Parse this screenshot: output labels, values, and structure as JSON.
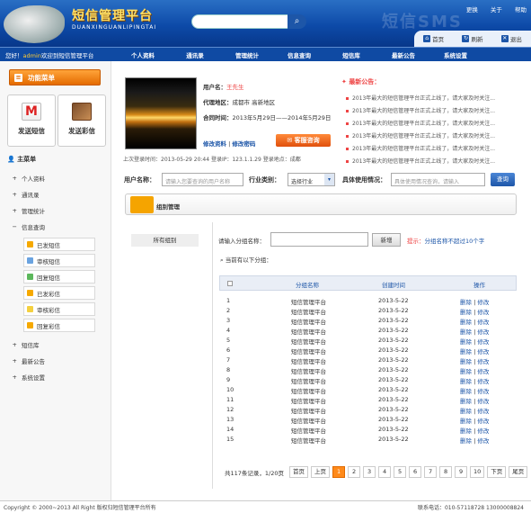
{
  "header": {
    "title": "短信管理平台",
    "subtitle": "DUANXINGUANLIPINGTAI",
    "watermark": "短信SMS",
    "top_links": [
      "更换",
      "关于",
      "帮助"
    ],
    "toolbar": [
      {
        "icon": "home-icon",
        "label": "首页"
      },
      {
        "icon": "refresh-icon",
        "label": "刷新"
      },
      {
        "icon": "logout-icon",
        "label": "退出"
      }
    ]
  },
  "nav": {
    "greeting_prefix": "您好！",
    "username": "admin",
    "greeting_suffix": "欢迎到短信管理平台",
    "items": [
      "个人资料",
      "通讯录",
      "管理统计",
      "信息查询",
      "短信库",
      "最新公告",
      "系统设置"
    ]
  },
  "sidebar": {
    "function_menu": "功能菜单",
    "send_sms": "发送短信",
    "send_mms": "发送彩信",
    "main_menu": "主菜单",
    "items": [
      "个人资料",
      "通讯录",
      "管理统计",
      "信息查询"
    ],
    "subitems": [
      "已发短信",
      "审核短信",
      "回复短信",
      "已发彩信",
      "审核彩信",
      "回复彩信"
    ],
    "items2": [
      "短信库",
      "最新公告",
      "系统设置"
    ]
  },
  "user": {
    "name_label": "用户名：",
    "name_value": "王先生",
    "region_label": "代理地区：",
    "region_value": "成都市 高新地区",
    "contract_label": "合同时间：",
    "contract_value": "2013年5月29日——2014年5月29日",
    "edit_profile": "修改资料",
    "sep": "|",
    "edit_password": "修改密码",
    "consult": "客服咨询",
    "last_login": "上次登录时间：2013-05-29  20:44  登录IP：123.1.1.29  登录地点：成都"
  },
  "notices": {
    "title": "最新公告：",
    "items": [
      "2013年最大的短信管理平台正式上线了，请大家及时关注...",
      "2013年最大的短信管理平台正式上线了，请大家及时关注...",
      "2013年最大的短信管理平台正式上线了，请大家及时关注...",
      "2013年最大的短信管理平台正式上线了，请大家及时关注...",
      "2013年最大的短信管理平台正式上线了，请大家及时关注...",
      "2013年最大的短信管理平台正式上线了，请大家及时关注..."
    ]
  },
  "query": {
    "user_label": "用户名称：",
    "user_placeholder": "请输入您要查询的用户名称",
    "industry_label": "行业类别：",
    "industry_value": "选择行业",
    "usage_label": "具体使用情况：",
    "usage_placeholder": "具体使用情况查询，请输入",
    "search": "查询"
  },
  "group": {
    "title": "组别管理",
    "all": "所有组别",
    "name_label": "请输入分组名称：",
    "new_btn": "新增",
    "tip_prefix": "提示：",
    "tip_text": "分组名称不超过10个字",
    "existing": "当前有以下分组：",
    "col_name": "分组名称",
    "col_time": "创建时间",
    "col_op": "操作",
    "rows": [
      {
        "no": "1",
        "name": "短信管理平台",
        "time": "2013-5-22",
        "del": "删除",
        "edit": "修改"
      },
      {
        "no": "2",
        "name": "短信管理平台",
        "time": "2013-5-22",
        "del": "删除",
        "edit": "修改"
      },
      {
        "no": "3",
        "name": "短信管理平台",
        "time": "2013-5-22",
        "del": "删除",
        "edit": "修改"
      },
      {
        "no": "4",
        "name": "短信管理平台",
        "time": "2013-5-22",
        "del": "删除",
        "edit": "修改"
      },
      {
        "no": "5",
        "name": "短信管理平台",
        "time": "2013-5-22",
        "del": "删除",
        "edit": "修改"
      },
      {
        "no": "6",
        "name": "短信管理平台",
        "time": "2013-5-22",
        "del": "删除",
        "edit": "修改"
      },
      {
        "no": "7",
        "name": "短信管理平台",
        "time": "2013-5-22",
        "del": "删除",
        "edit": "修改"
      },
      {
        "no": "8",
        "name": "短信管理平台",
        "time": "2013-5-22",
        "del": "删除",
        "edit": "修改"
      },
      {
        "no": "9",
        "name": "短信管理平台",
        "time": "2013-5-22",
        "del": "删除",
        "edit": "修改"
      },
      {
        "no": "10",
        "name": "短信管理平台",
        "time": "2013-5-22",
        "del": "删除",
        "edit": "修改"
      },
      {
        "no": "11",
        "name": "短信管理平台",
        "time": "2013-5-22",
        "del": "删除",
        "edit": "修改"
      },
      {
        "no": "12",
        "name": "短信管理平台",
        "time": "2013-5-22",
        "del": "删除",
        "edit": "修改"
      },
      {
        "no": "13",
        "name": "短信管理平台",
        "time": "2013-5-22",
        "del": "删除",
        "edit": "修改"
      },
      {
        "no": "14",
        "name": "短信管理平台",
        "time": "2013-5-22",
        "del": "删除",
        "edit": "修改"
      },
      {
        "no": "15",
        "name": "短信管理平台",
        "time": "2013-5-22",
        "del": "删除",
        "edit": "修改"
      }
    ]
  },
  "pager": {
    "info": "共117条记录，1/20页",
    "first": "首页",
    "prev": "上页",
    "pages": [
      "1",
      "2",
      "3",
      "4",
      "5",
      "6",
      "7",
      "8",
      "9",
      "10"
    ],
    "current": "1",
    "next": "下页",
    "last": "尾页"
  },
  "footer": {
    "copyright": "Copyright © 2000~2013 All Right  版权归短信管理平台所有",
    "contact": "联系电话：010-57118728  13000008824"
  },
  "colors": {
    "brand": "#0f4aa3",
    "accent": "#ff8a1a",
    "alert": "#ee4444"
  }
}
